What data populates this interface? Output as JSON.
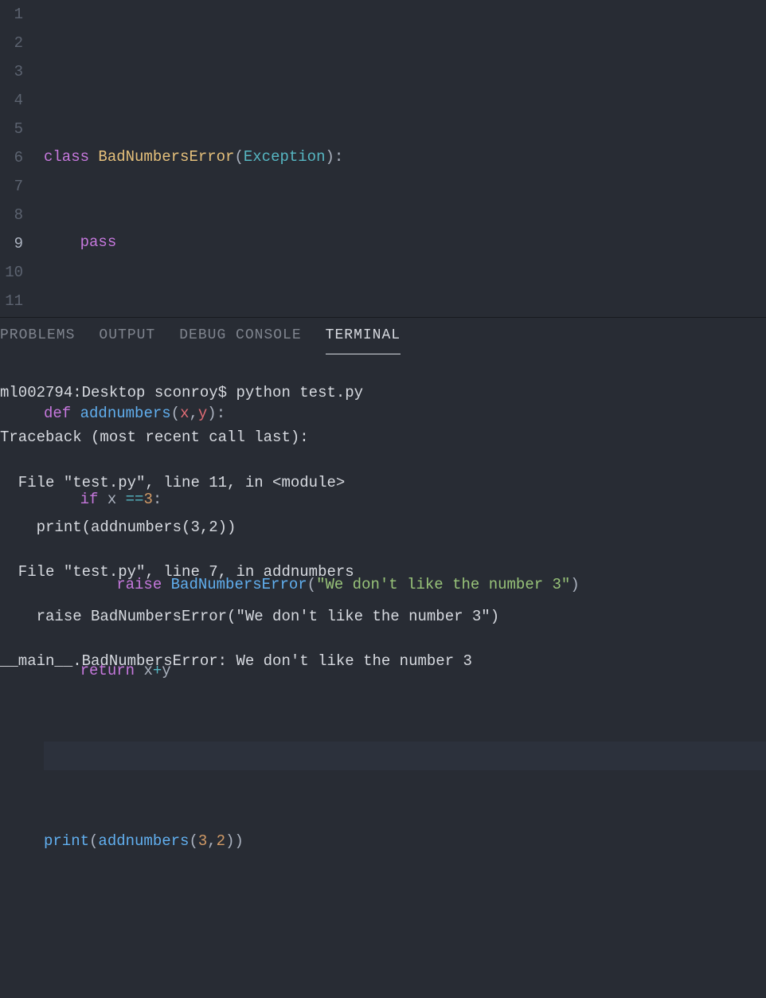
{
  "editor": {
    "line_numbers": [
      "1",
      "2",
      "3",
      "4",
      "5",
      "6",
      "7",
      "8",
      "9",
      "10",
      "11"
    ],
    "lines": {
      "l1": "",
      "l2": {
        "kw_class": "class",
        "sp": " ",
        "classname": "BadNumbersError",
        "op": "(",
        "base": "Exception",
        "cp": ")",
        ":": ":"
      },
      "l3": {
        "indent": "    ",
        "pass": "pass"
      },
      "l4": "",
      "l5": {
        "kw_def": "def",
        "sp": " ",
        "fn": "addnumbers",
        "op": "(",
        "p1": "x",
        "c": ",",
        "p2": "y",
        "cp": ")",
        ":": ":"
      },
      "l6": {
        "indent": "    ",
        "if": "if",
        "sp": " ",
        "var": "x",
        "sp2": " ",
        "eq": "==",
        "num": "3",
        ":": ":"
      },
      "l7": {
        "indent": "        ",
        "raise": "raise",
        "sp": " ",
        "cls": "BadNumbersError",
        "op": "(",
        "str": "\"We don't like the number 3\"",
        "cp": ")"
      },
      "l8": {
        "indent": "    ",
        "return": "return",
        "sp": " ",
        "v1": "x",
        "plus": "+",
        "v2": "y"
      },
      "l9": "",
      "l10": {
        "fn": "print",
        "op": "(",
        "fn2": "addnumbers",
        "op2": "(",
        "n1": "3",
        "c": ",",
        "n2": "2",
        "cp": ")",
        "cp2": ")"
      },
      "l11": ""
    }
  },
  "panel": {
    "tabs": {
      "problems": "PROBLEMS",
      "output": "OUTPUT",
      "debug": "DEBUG CONSOLE",
      "terminal": "TERMINAL"
    },
    "terminal_lines": [
      "ml002794:Desktop sconroy$ python test.py",
      "Traceback (most recent call last):",
      "  File \"test.py\", line 11, in <module>",
      "    print(addnumbers(3,2))",
      "  File \"test.py\", line 7, in addnumbers",
      "    raise BadNumbersError(\"We don't like the number 3\")",
      "__main__.BadNumbersError: We don't like the number 3"
    ]
  }
}
